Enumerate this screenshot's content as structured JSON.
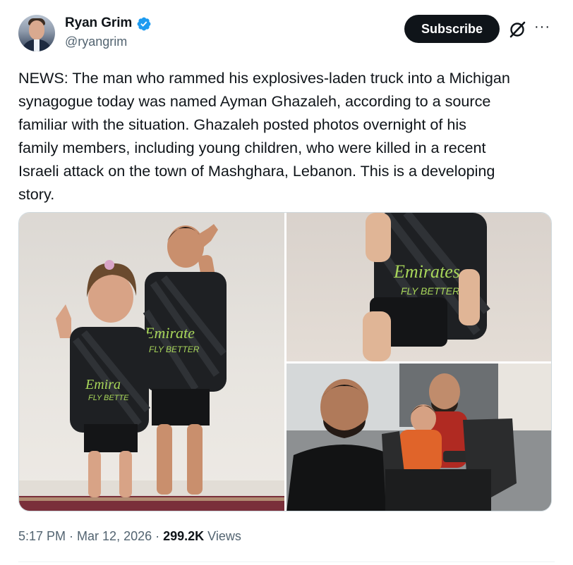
{
  "author": {
    "name": "Ryan Grim",
    "handle": "@ryangrim",
    "verified": true
  },
  "actions": {
    "subscribe_label": "Subscribe",
    "grok_icon": "grok-icon",
    "more_icon": "more-icon",
    "more_glyph": "···"
  },
  "tweet": {
    "text": "NEWS: The man who rammed his explosives-laden truck into a Michigan\nsynagogue today was named Ayman Ghazaleh, according to a source\nfamiliar with the situation. Ghazaleh posted photos overnight of his\nfamily members, including young children, who were killed in a recent\nIsraeli attack on the town of Mashghara, Lebanon. This is a developing\nstory."
  },
  "media": {
    "photo_1_jersey_text_a": "Emirate",
    "photo_1_jersey_sub_a": "FLY BETTER",
    "photo_1_jersey_text_b": "Emira",
    "photo_1_jersey_sub_b": "FLY BETTE",
    "photo_2_jersey_text": "Emirates",
    "photo_2_jersey_sub": "FLY BETTER"
  },
  "meta": {
    "time": "5:17 PM",
    "separator": " · ",
    "date": "Mar 12, 2026",
    "views_count": "299.2K",
    "views_label": " Views"
  },
  "colors": {
    "text_primary": "#0f1419",
    "text_secondary": "#536471",
    "verified_blue": "#1d9bf0",
    "border": "#cfd9de"
  }
}
